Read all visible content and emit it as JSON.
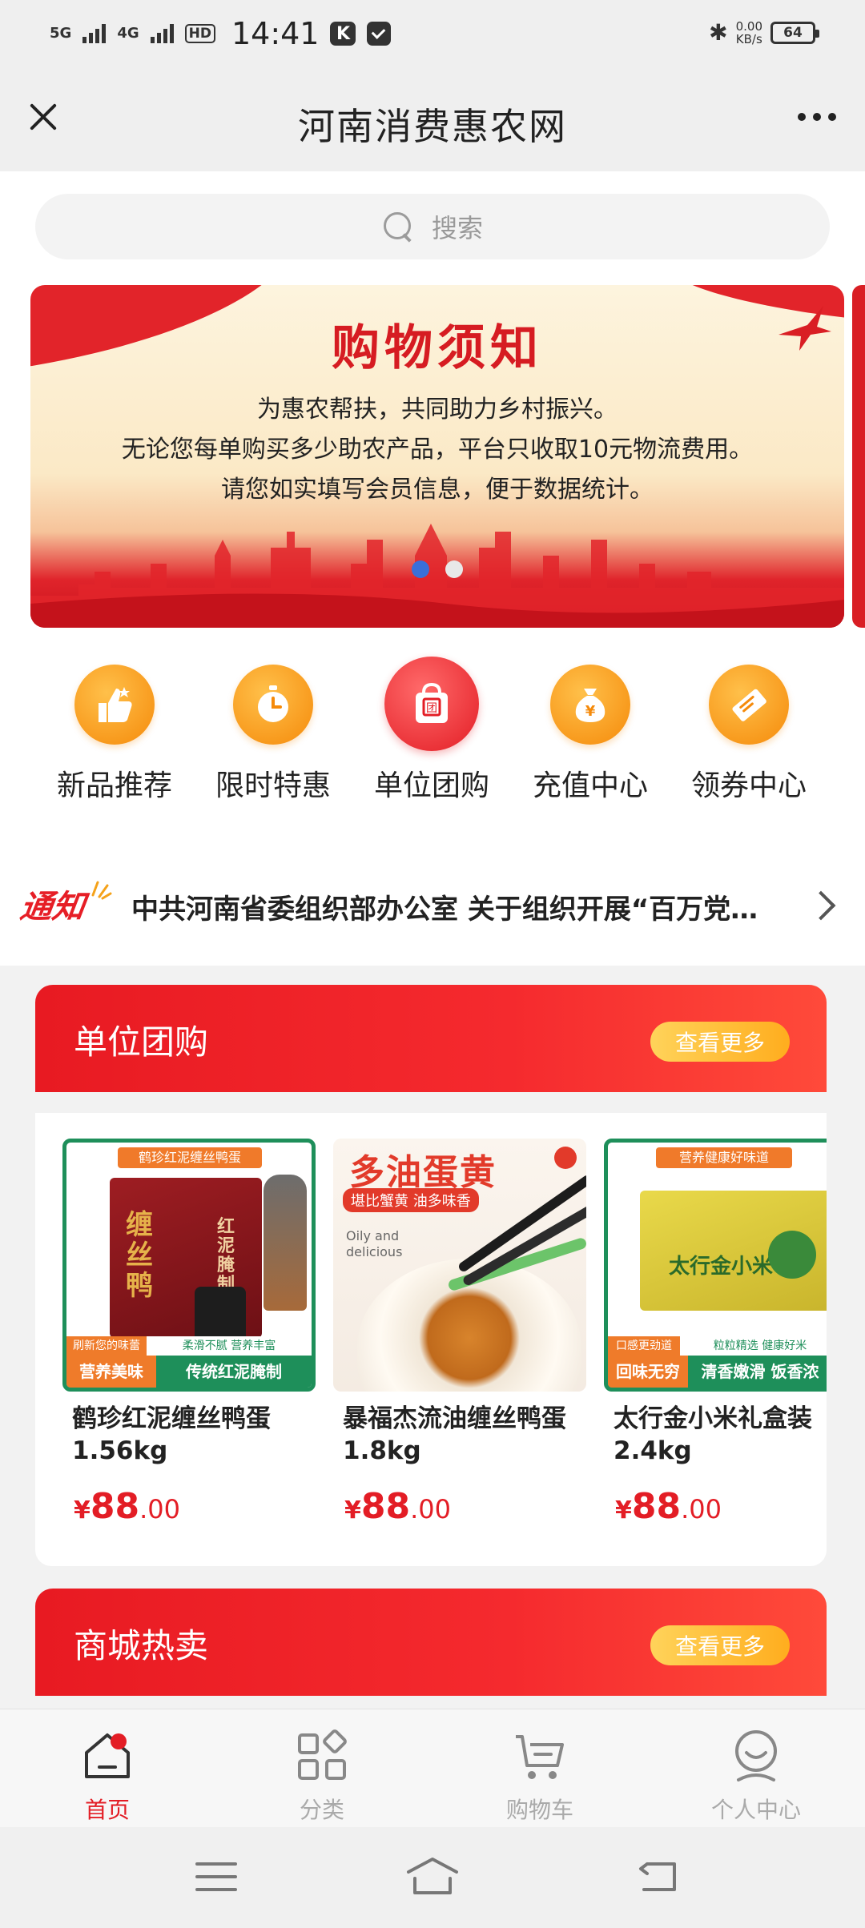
{
  "status_bar": {
    "net1": "5G",
    "net2": "4G",
    "hd": "HD",
    "time": "14:41",
    "k_badge": "K",
    "speed_value": "0.00",
    "speed_unit": "KB/s",
    "battery": "64"
  },
  "titlebar": {
    "title": "河南消费惠农网"
  },
  "search": {
    "placeholder": "搜索"
  },
  "banner": {
    "title": "购物须知",
    "lines": [
      "为惠农帮扶，共同助力乡村振兴。",
      "无论您每单购买多少助农产品，平台只收取10元物流费用。",
      "请您如实填写会员信息，便于数据统计。"
    ],
    "dot_count": 2,
    "active_dot": 0
  },
  "quick_links": [
    {
      "label": "新品推荐",
      "icon": "thumbs-up-icon"
    },
    {
      "label": "限时特惠",
      "icon": "stopwatch-icon"
    },
    {
      "label": "单位团购",
      "icon": "group-bag-icon"
    },
    {
      "label": "充值中心",
      "icon": "money-bag-icon"
    },
    {
      "label": "领券中心",
      "icon": "coupon-icon"
    }
  ],
  "notice": {
    "badge": "通知",
    "text": "中共河南省委组织部办公室 关于组织开展“百万党…"
  },
  "group_buy": {
    "title": "单位团购",
    "more": "查看更多",
    "products": [
      {
        "name": "鹤珍红泥缠丝鸭蛋1.56kg",
        "currency": "¥",
        "price_int": "88",
        "price_dec": ".00",
        "img": {
          "tag_top": "鹤珍红泥缠丝鸭蛋",
          "box_text": "缠丝鸭",
          "box_side": "红泥腌制",
          "strip_left": "刷新您的味蕾",
          "strip_right": "柔滑不腻 营养丰富",
          "bar_left": "营养美味",
          "bar_right": "传统红泥腌制"
        }
      },
      {
        "name": "暴福杰流油缠丝鸭蛋1.8kg",
        "currency": "¥",
        "price_int": "88",
        "price_dec": ".00",
        "img": {
          "headline": "多油蛋黄",
          "sub": "堪比蟹黄  油多味香",
          "en1": "Oily and",
          "en2": "delicious"
        }
      },
      {
        "name": "太行金小米礼盒装2.4kg",
        "currency": "¥",
        "price_int": "88",
        "price_dec": ".00",
        "img": {
          "tag_top": "营养健康好味道",
          "box_text": "太行金小米",
          "strip_left": "口感更劲道",
          "strip_right": "粒粒精选 健康好米",
          "bar_left": "回味无穷",
          "bar_right": "清香嫩滑 饭香浓"
        }
      }
    ]
  },
  "hot_sale": {
    "title": "商城热卖",
    "more": "查看更多"
  },
  "bottom_nav": [
    {
      "label": "首页",
      "icon": "home-icon",
      "active": true
    },
    {
      "label": "分类",
      "icon": "category-icon",
      "active": false
    },
    {
      "label": "购物车",
      "icon": "cart-icon",
      "active": false
    },
    {
      "label": "个人中心",
      "icon": "profile-icon",
      "active": false
    }
  ],
  "colors": {
    "brand_red": "#e31d25",
    "accent_orange": "#f58a0a",
    "more_pill": "#ffad1e",
    "active_dot": "#3a6fd9"
  }
}
